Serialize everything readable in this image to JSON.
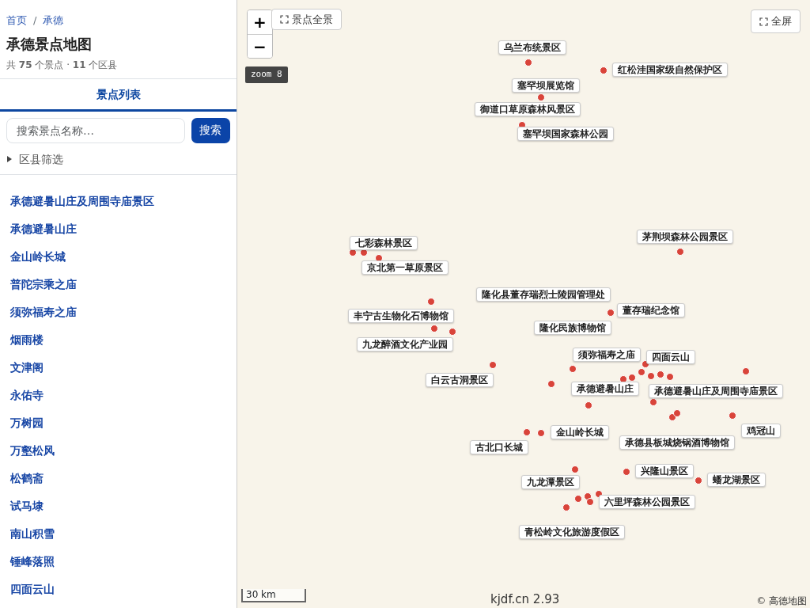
{
  "breadcrumb": [
    "首页",
    "承德"
  ],
  "breadcrumb_separator": "/",
  "title": "承德景点地图",
  "summary": "共 **75** 个景点 · **11** 个区县",
  "tabs": [
    {
      "label": "景点列表",
      "selected": true
    }
  ],
  "search": {
    "placeholder": "搜索景点名称…",
    "button": "搜索"
  },
  "filter": {
    "label": "区县筛选",
    "expanded": false
  },
  "spots": [
    "承德避暑山庄及周围寺庙景区",
    "承德避暑山庄",
    "金山岭长城",
    "普陀宗乘之庙",
    "须弥福寿之庙",
    "烟雨楼",
    "文津阁",
    "永佑寺",
    "万树园",
    "万壑松风",
    "松鹤斋",
    "试马埭",
    "南山积雪",
    "锤峰落照",
    "四面云山"
  ],
  "map": {
    "zoom_in": "+",
    "zoom_out": "−",
    "overview_button": "景点全景",
    "zoom_badge": "zoom 8",
    "fullscreen_button": "全屏",
    "labels": [
      "乌兰布统景区",
      "红松洼国家级自然保护区",
      "塞罕坝展览馆",
      "御道口草原森林风景区",
      "塞罕坝国家森林公园",
      "茅荆坝森林公园景区",
      "七彩森林景区",
      "京北第一草原景区",
      "隆化县董存瑞烈士陵园管理处",
      "董存瑞纪念馆",
      "丰宁古生物化石博物馆",
      "隆化民族博物馆",
      "九龙醉酒文化产业园",
      "须弥福寿之庙",
      "四面云山",
      "白云古洞景区",
      "承德避暑山庄",
      "承德避暑山庄及周围寺庙景区",
      "金山岭长城",
      "鸡冠山",
      "古北口长城",
      "承德县板城烧锅酒博物馆",
      "兴隆山景区",
      "蟠龙湖景区",
      "九龙潭景区",
      "六里坪森林公园景区",
      "青松岭文化旅游度假区"
    ],
    "scale": "30 km",
    "version": "kjdf.cn 2.93",
    "attribution": "© 高德地图"
  }
}
